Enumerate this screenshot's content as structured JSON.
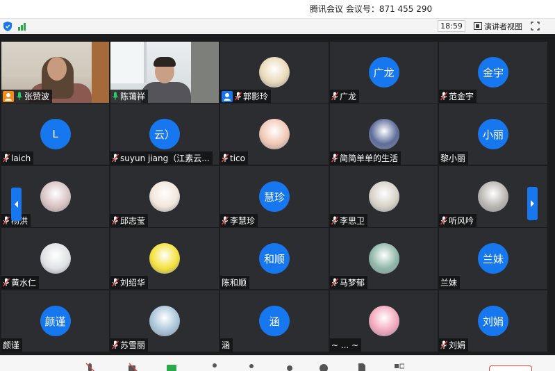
{
  "window": {
    "title": "腾讯会议 会议号：871 455 290"
  },
  "status": {
    "time": "18:59",
    "speaker_view_label": "演讲者视图"
  },
  "participants": [
    {
      "name": "张赞波",
      "avatar": "",
      "kind": "video1",
      "mic": "on",
      "badge": "host-orange"
    },
    {
      "name": "陈蔼祥",
      "avatar": "",
      "kind": "video2",
      "mic": "on",
      "active": true
    },
    {
      "name": "郭影玲",
      "avatar": "",
      "kind": "pic",
      "mic": "off",
      "badge": "host-blue",
      "pic_color": "#e9d9b8"
    },
    {
      "name": "广龙",
      "avatar": "广龙",
      "kind": "text",
      "mic": "off"
    },
    {
      "name": "范金宇",
      "avatar": "金宇",
      "kind": "text",
      "mic": "off"
    },
    {
      "name": "laich",
      "avatar": "L",
      "kind": "text",
      "mic": "off"
    },
    {
      "name": "suyun jiang（江素云...",
      "avatar": "云）",
      "kind": "text",
      "mic": "off"
    },
    {
      "name": "tico",
      "avatar": "",
      "kind": "pic",
      "mic": "off",
      "pic_color": "#f1c7b4"
    },
    {
      "name": "简简单单的生活",
      "avatar": "",
      "kind": "pic",
      "mic": "off",
      "pic_color": "#5d6c9a"
    },
    {
      "name": "黎小丽",
      "avatar": "小丽",
      "kind": "text",
      "mic": "none"
    },
    {
      "name": "杨洪",
      "avatar": "",
      "kind": "pic",
      "mic": "off",
      "pic_color": "#d8c3c2"
    },
    {
      "name": "邱志莹",
      "avatar": "",
      "kind": "pic",
      "mic": "off",
      "pic_color": "#f2e6da"
    },
    {
      "name": "李慧珍",
      "avatar": "慧珍",
      "kind": "text",
      "mic": "off"
    },
    {
      "name": "李思卫",
      "avatar": "",
      "kind": "pic",
      "mic": "off",
      "pic_color": "#d7d1c7"
    },
    {
      "name": "听风吟",
      "avatar": "",
      "kind": "pic",
      "mic": "off",
      "pic_color": "#b9b6b0"
    },
    {
      "name": "黄水仁",
      "avatar": "",
      "kind": "pic",
      "mic": "off",
      "pic_color": "#dfe3e6"
    },
    {
      "name": "刘绍华",
      "avatar": "",
      "kind": "pic",
      "mic": "off",
      "pic_color": "#f4e23a"
    },
    {
      "name": "陈和顺",
      "avatar": "和顺",
      "kind": "text",
      "mic": "none"
    },
    {
      "name": "马梦郁",
      "avatar": "",
      "kind": "pic",
      "mic": "off",
      "pic_color": "#8fb7a8"
    },
    {
      "name": "兰妹",
      "avatar": "兰妹",
      "kind": "text",
      "mic": "none"
    },
    {
      "name": "颜谨",
      "avatar": "颜谨",
      "kind": "text",
      "mic": "none"
    },
    {
      "name": "苏雪丽",
      "avatar": "",
      "kind": "pic",
      "mic": "off",
      "pic_color": "#a9c5d9"
    },
    {
      "name": "涵",
      "avatar": "涵",
      "kind": "text",
      "mic": "none"
    },
    {
      "name": "~ ... ~",
      "avatar": "",
      "kind": "pic",
      "mic": "none",
      "pic_color": "#f3a7bd"
    },
    {
      "name": "刘娟",
      "avatar": "刘娟",
      "kind": "text",
      "mic": "off"
    }
  ],
  "colors": {
    "accent_blue": "#1677ee",
    "grid_bg": "#1b1c1e",
    "tile_bg": "#2c2d30",
    "muted_red": "#e0413a",
    "active_green": "#24c25e"
  }
}
